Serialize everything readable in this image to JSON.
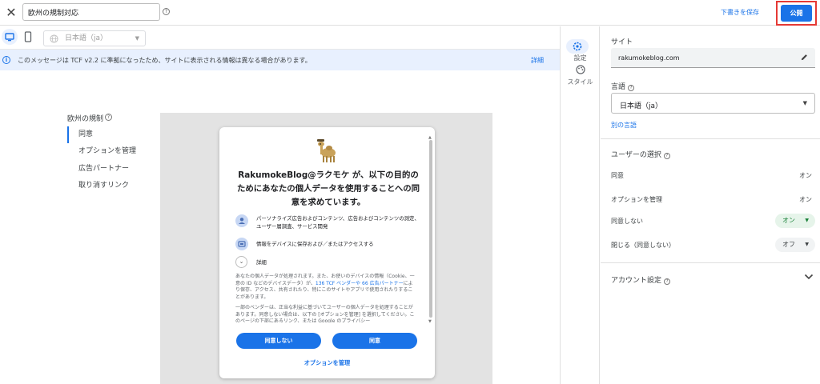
{
  "header": {
    "title_value": "欧州の規制対応",
    "save_draft_label": "下書きを保存",
    "publish_label": "公開"
  },
  "device_bar": {
    "language_value": "日本語（ja）"
  },
  "banner": {
    "message": "このメッセージは TCF v2.2 に準拠になったため、サイトに表示される情報は異なる場合があります。",
    "detail_label": "詳細"
  },
  "left_nav": {
    "title": "欧州の規制",
    "items": [
      {
        "label": "同意",
        "active": true
      },
      {
        "label": "オプションを管理",
        "active": false
      },
      {
        "label": "広告パートナー",
        "active": false
      },
      {
        "label": "取り消すリンク",
        "active": false
      }
    ]
  },
  "dialog": {
    "heading": "RakumokeBlog@ラクモケ が、以下の目的のためにあなたの個人データを使用することへの同意を求めています。",
    "purposes": [
      {
        "icon": "person-icon",
        "text": "パーソナライズ広告およびコンテンツ、広告およびコンテンツの測定、ユーザー層調査、サービス開発"
      },
      {
        "icon": "device-storage-icon",
        "text": "情報をデバイスに保存および／またはアクセスする"
      }
    ],
    "detail_label": "詳細",
    "para1_a": "あなたの個人データが処理されます。また、お使いのデバイスの情報（Cookie、一意の ID などのデバイスデータ）が、",
    "para1_link": "136 TCF ベンダーや 66 広告パートナー",
    "para1_b": "により保存、アクセス、共有されたり、特にこのサイトやアプリで使用されたりすることがあります。",
    "para2": "一部のベンダーは、正当な利益に基づいてユーザーの個人データを処理することがあります。同意しない場合は、以下の [オプションを管理] を選択してください。このページの下部にあるリンク、または Google のプライバシー",
    "disagree_label": "同意しない",
    "agree_label": "同意",
    "manage_label": "オプションを管理"
  },
  "rail": {
    "settings_label": "設定",
    "style_label": "スタイル"
  },
  "panel": {
    "site_label": "サイト",
    "site_value": "rakumokeblog.com",
    "language_label": "言語",
    "language_value": "日本語（ja）",
    "other_lang_label": "別の言語",
    "user_choice_label": "ユーザーの選択",
    "choices": [
      {
        "label": "同意",
        "state": "オン"
      },
      {
        "label": "オプションを管理",
        "state": "オン"
      },
      {
        "label": "同意しない",
        "state": "オン"
      },
      {
        "label": "閉じる（同意しない）",
        "state": "オフ"
      }
    ],
    "account_label": "アカウント設定"
  },
  "colors": {
    "accent": "#1a73e8",
    "highlight": "#e53935",
    "on_green": "#188038"
  }
}
